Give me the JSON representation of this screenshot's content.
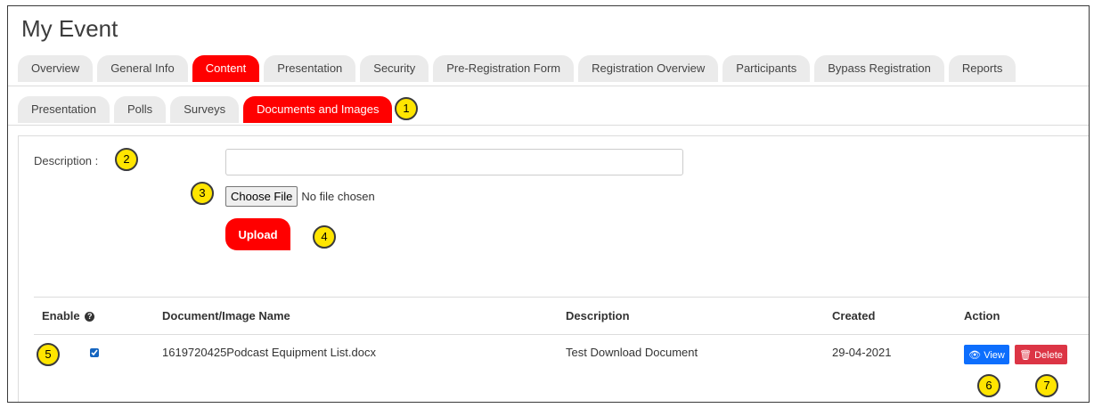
{
  "page": {
    "title": "My Event"
  },
  "main_tabs": [
    {
      "label": "Overview"
    },
    {
      "label": "General Info"
    },
    {
      "label": "Content"
    },
    {
      "label": "Presentation"
    },
    {
      "label": "Security"
    },
    {
      "label": "Pre-Registration Form"
    },
    {
      "label": "Registration Overview"
    },
    {
      "label": "Participants"
    },
    {
      "label": "Bypass Registration"
    },
    {
      "label": "Reports"
    }
  ],
  "main_active": "Content",
  "sub_tabs": [
    {
      "label": "Presentation"
    },
    {
      "label": "Polls"
    },
    {
      "label": "Surveys"
    },
    {
      "label": "Documents and Images"
    }
  ],
  "sub_active": "Documents and Images",
  "form": {
    "description_label": "Description :",
    "description_value": "",
    "choose_file_label": "Choose File",
    "no_file_text": "No file chosen",
    "upload_label": "Upload"
  },
  "table": {
    "headers": {
      "enable": "Enable",
      "name": "Document/Image Name",
      "description": "Description",
      "created": "Created",
      "action": "Action"
    },
    "rows": [
      {
        "enabled": true,
        "name": "1619720425Podcast Equipment List.docx",
        "description": "Test Download Document",
        "created": "29-04-2021",
        "view_label": "View",
        "delete_label": "Delete"
      }
    ]
  },
  "callouts": [
    "1",
    "2",
    "3",
    "4",
    "5",
    "6",
    "7"
  ],
  "icons": {
    "help": "question-circle-icon",
    "view": "eye-icon",
    "delete": "trash-icon"
  },
  "colors": {
    "accent": "#ff0000",
    "view": "#0d6efd",
    "delete": "#dc3545",
    "callout": "#ffe500"
  }
}
